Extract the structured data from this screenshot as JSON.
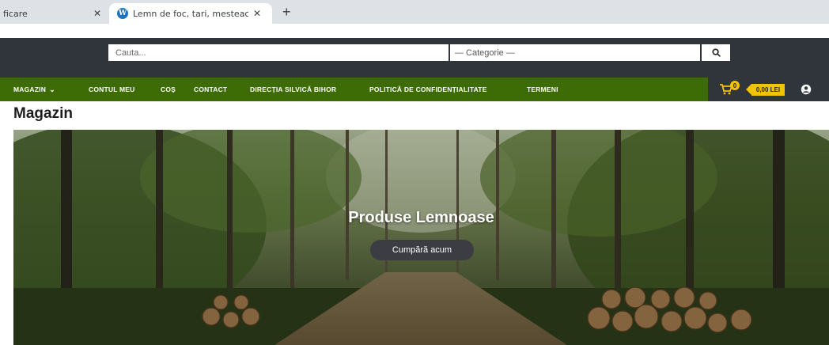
{
  "browser": {
    "tabs": [
      {
        "label": "ficare",
        "close": "✕"
      },
      {
        "label": "Lemn de foc, tari, mesteacăn, răș",
        "close": "✕"
      }
    ],
    "new_tab": "+"
  },
  "header": {
    "search_placeholder": "Cauta...",
    "category_label": "— Categorie —",
    "search_icon": "search-icon"
  },
  "nav": {
    "items": [
      {
        "label": "MAGAZIN"
      },
      {
        "label": "CONTUL MEU"
      },
      {
        "label": "COȘ"
      },
      {
        "label": "CONTACT"
      },
      {
        "label": "DIRECȚIA SILVICĂ BIHOR"
      },
      {
        "label": "POLITICĂ DE CONFIDENȚIALITATE"
      },
      {
        "label": "TERMENI"
      }
    ],
    "chevron": "⌄",
    "cart_count": "0",
    "cart_total": "0,00 LEI",
    "colors": {
      "nav_bg": "#3d6b05",
      "header_bg": "#2f353b",
      "accent": "#f2c400"
    }
  },
  "page": {
    "title": "Magazin"
  },
  "hero": {
    "title": "Produse Lemnoase",
    "button_label": "Cumpără acum"
  }
}
